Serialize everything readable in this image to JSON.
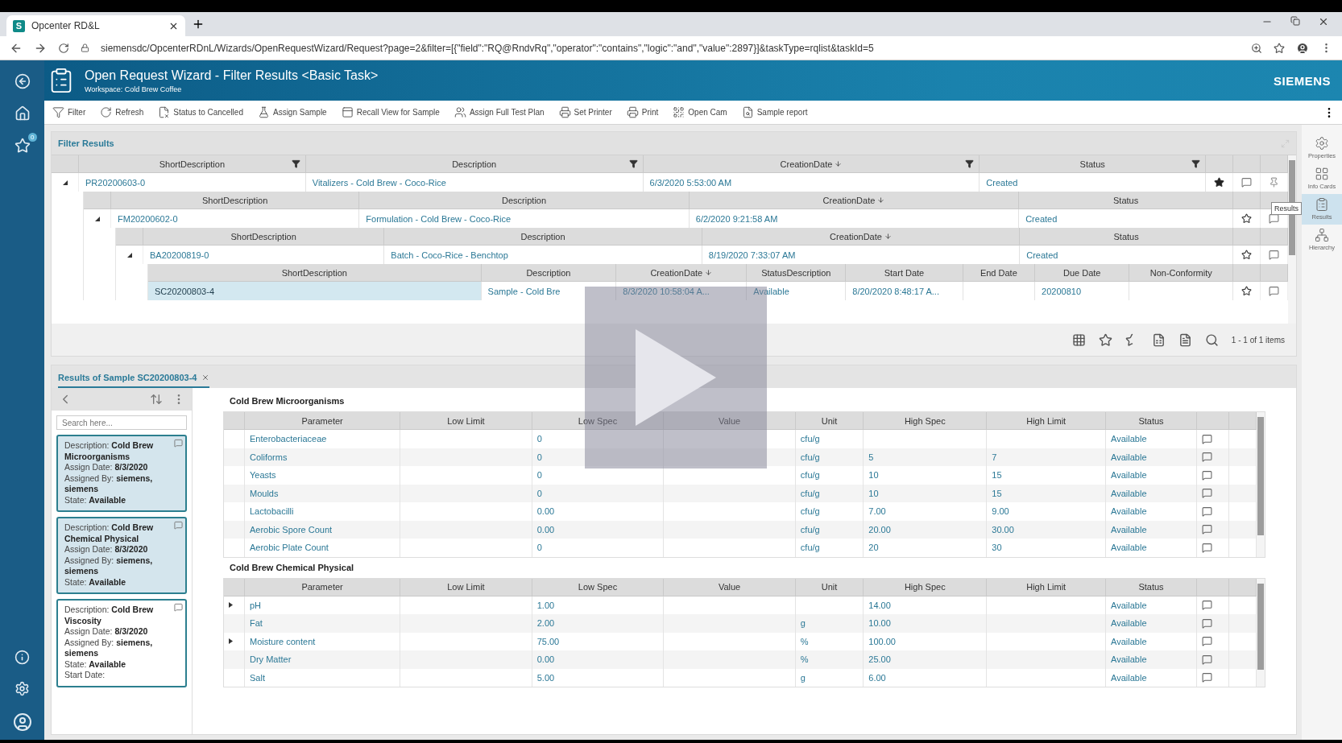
{
  "browser": {
    "favicon": "S",
    "tab_title": "Opcenter RD&L",
    "url": "siemensdc/OpcenterRDnL/Wizards/OpenRequestWizard/Request?page=2&filter=[{\"field\":\"RQ@RndvRq\",\"operator\":\"contains\",\"logic\":\"and\",\"value\":2897}]&taskType=rqlist&taskId=5"
  },
  "app": {
    "title": "Open Request Wizard - Filter Results <Basic Task>",
    "workspace": "Workspace: Cold Brew Coffee",
    "brand": "SIEMENS",
    "favorites_badge": "0"
  },
  "toolbar": [
    "Filter",
    "Refresh",
    "Status to Cancelled",
    "Assign Sample",
    "Recall View for Sample",
    "Assign Full Test Plan",
    "Set Printer",
    "Print",
    "Open Cam",
    "Sample report"
  ],
  "filter_results": {
    "title": "Filter Results",
    "grid": {
      "columns": [
        {
          "label": "ShortDescription",
          "filter": true,
          "sorted": false
        },
        {
          "label": "Description",
          "filter": true,
          "sorted": false
        },
        {
          "label": "CreationDate",
          "filter": true,
          "sorted": true
        },
        {
          "label": "Status",
          "filter": true,
          "sorted": false
        }
      ],
      "rows": [
        {
          "cells": [
            "PR20200603-0",
            "Vitalizers - Cold Brew - Coco-Rice",
            "6/3/2020 5:53:00 AM",
            "Created"
          ],
          "expanded": true,
          "starred": true,
          "selected": false
        }
      ],
      "child": {
        "columns": [
          {
            "label": "ShortDescription",
            "filter": false,
            "sorted": false
          },
          {
            "label": "Description",
            "filter": false,
            "sorted": false
          },
          {
            "label": "CreationDate",
            "filter": false,
            "sorted": true
          },
          {
            "label": "Status",
            "filter": false,
            "sorted": false
          }
        ],
        "rows": [
          {
            "cells": [
              "FM20200602-0",
              "Formulation - Cold Brew - Coco-Rice",
              "6/2/2020 9:21:58 AM",
              "Created"
            ],
            "expanded": true,
            "starred": false,
            "selected": false
          }
        ],
        "child": {
          "columns": [
            {
              "label": "ShortDescription",
              "filter": false,
              "sorted": false
            },
            {
              "label": "Description",
              "filter": false,
              "sorted": false
            },
            {
              "label": "CreationDate",
              "filter": false,
              "sorted": true
            },
            {
              "label": "Status",
              "filter": false,
              "sorted": false
            }
          ],
          "rows": [
            {
              "cells": [
                "BA20200819-0",
                "Batch - Coco-Rice - Benchtop",
                "8/19/2020 7:33:07 AM",
                "Created"
              ],
              "expanded": true,
              "starred": false,
              "selected": false
            }
          ],
          "child": {
            "columns": [
              {
                "label": "ShortDescription",
                "filter": false,
                "sorted": false
              },
              {
                "label": "Description",
                "filter": false,
                "sorted": false
              },
              {
                "label": "CreationDate",
                "filter": false,
                "sorted": true
              },
              {
                "label": "StatusDescription",
                "filter": false,
                "sorted": false
              },
              {
                "label": "Start Date",
                "filter": false,
                "sorted": false
              },
              {
                "label": "End Date",
                "filter": false,
                "sorted": false
              },
              {
                "label": "Due Date",
                "filter": false,
                "sorted": false
              },
              {
                "label": "Non-Conformity",
                "filter": false,
                "sorted": false
              }
            ],
            "rows": [
              {
                "cells": [
                  "SC20200803-4",
                  "Sample - Cold Bre",
                  "8/3/2020 10:58:04 A...",
                  "Available",
                  "8/20/2020 8:48:17 A...",
                  "",
                  "20200810",
                  ""
                ],
                "starred": false,
                "selected": true
              }
            ]
          }
        }
      }
    },
    "pager": "1 - 1 of 1 items"
  },
  "right_panel": {
    "items": [
      {
        "label": "Properties",
        "selected": false
      },
      {
        "label": "Info Cards",
        "selected": false
      },
      {
        "label": "Results",
        "selected": true
      },
      {
        "label": "Hierarchy",
        "selected": false
      }
    ],
    "tooltip": "Results"
  },
  "results": {
    "tab_title": "Results of Sample SC20200803-4",
    "search": {
      "placeholder": "Search here..."
    },
    "cards": [
      {
        "lines": [
          "Description: **Cold Brew Microorganisms**",
          "Assign Date: **8/3/2020**",
          "Assigned By: **siemens, siemens**",
          "State: **Available**"
        ],
        "selected": true
      },
      {
        "lines": [
          "Description: **Cold Brew Chemical Physical**",
          "Assign Date: **8/3/2020**",
          "Assigned By: **siemens, siemens**",
          "State: **Available**"
        ],
        "selected": true
      },
      {
        "lines": [
          "Description: **Cold Brew Viscosity**",
          "Assign Date: **8/3/2020**",
          "Assigned By: **siemens, siemens**",
          "State: **Available**",
          "Start Date:"
        ],
        "selected": false
      }
    ],
    "groups": [
      {
        "title": "Cold Brew Microorganisms",
        "columns": [
          "Parameter",
          "Low Limit",
          "Low Spec",
          "Value",
          "Unit",
          "High Spec",
          "High Limit",
          "Status"
        ],
        "rows": [
          {
            "expandable": false,
            "cells": [
              "Enterobacteriaceae",
              "",
              "0",
              "",
              "cfu/g",
              "",
              "",
              "Available"
            ]
          },
          {
            "expandable": false,
            "cells": [
              "Coliforms",
              "",
              "0",
              "",
              "cfu/g",
              "5",
              "7",
              "Available"
            ]
          },
          {
            "expandable": false,
            "cells": [
              "Yeasts",
              "",
              "0",
              "",
              "cfu/g",
              "10",
              "15",
              "Available"
            ]
          },
          {
            "expandable": false,
            "cells": [
              "Moulds",
              "",
              "0",
              "",
              "cfu/g",
              "10",
              "15",
              "Available"
            ]
          },
          {
            "expandable": false,
            "cells": [
              "Lactobacilli",
              "",
              "0.00",
              "",
              "cfu/g",
              "7.00",
              "9.00",
              "Available"
            ]
          },
          {
            "expandable": false,
            "cells": [
              "Aerobic Spore Count",
              "",
              "0.00",
              "",
              "cfu/g",
              "20.00",
              "30.00",
              "Available"
            ]
          },
          {
            "expandable": false,
            "cells": [
              "Aerobic Plate Count",
              "",
              "0",
              "",
              "cfu/g",
              "20",
              "30",
              "Available"
            ]
          }
        ]
      },
      {
        "title": "Cold Brew Chemical Physical",
        "columns": [
          "Parameter",
          "Low Limit",
          "Low Spec",
          "Value",
          "Unit",
          "High Spec",
          "High Limit",
          "Status"
        ],
        "rows": [
          {
            "expandable": true,
            "cells": [
              "pH",
              "",
              "1.00",
              "",
              "",
              "14.00",
              "",
              "Available"
            ]
          },
          {
            "expandable": false,
            "cells": [
              "Fat",
              "",
              "2.00",
              "",
              "g",
              "10.00",
              "",
              "Available"
            ]
          },
          {
            "expandable": true,
            "cells": [
              "Moisture content",
              "",
              "75.00",
              "",
              "%",
              "100.00",
              "",
              "Available"
            ]
          },
          {
            "expandable": false,
            "cells": [
              "Dry Matter",
              "",
              "0.00",
              "",
              "%",
              "25.00",
              "",
              "Available"
            ]
          },
          {
            "expandable": false,
            "cells": [
              "Salt",
              "",
              "5.00",
              "",
              "g",
              "6.00",
              "",
              "Available"
            ]
          }
        ]
      }
    ]
  }
}
